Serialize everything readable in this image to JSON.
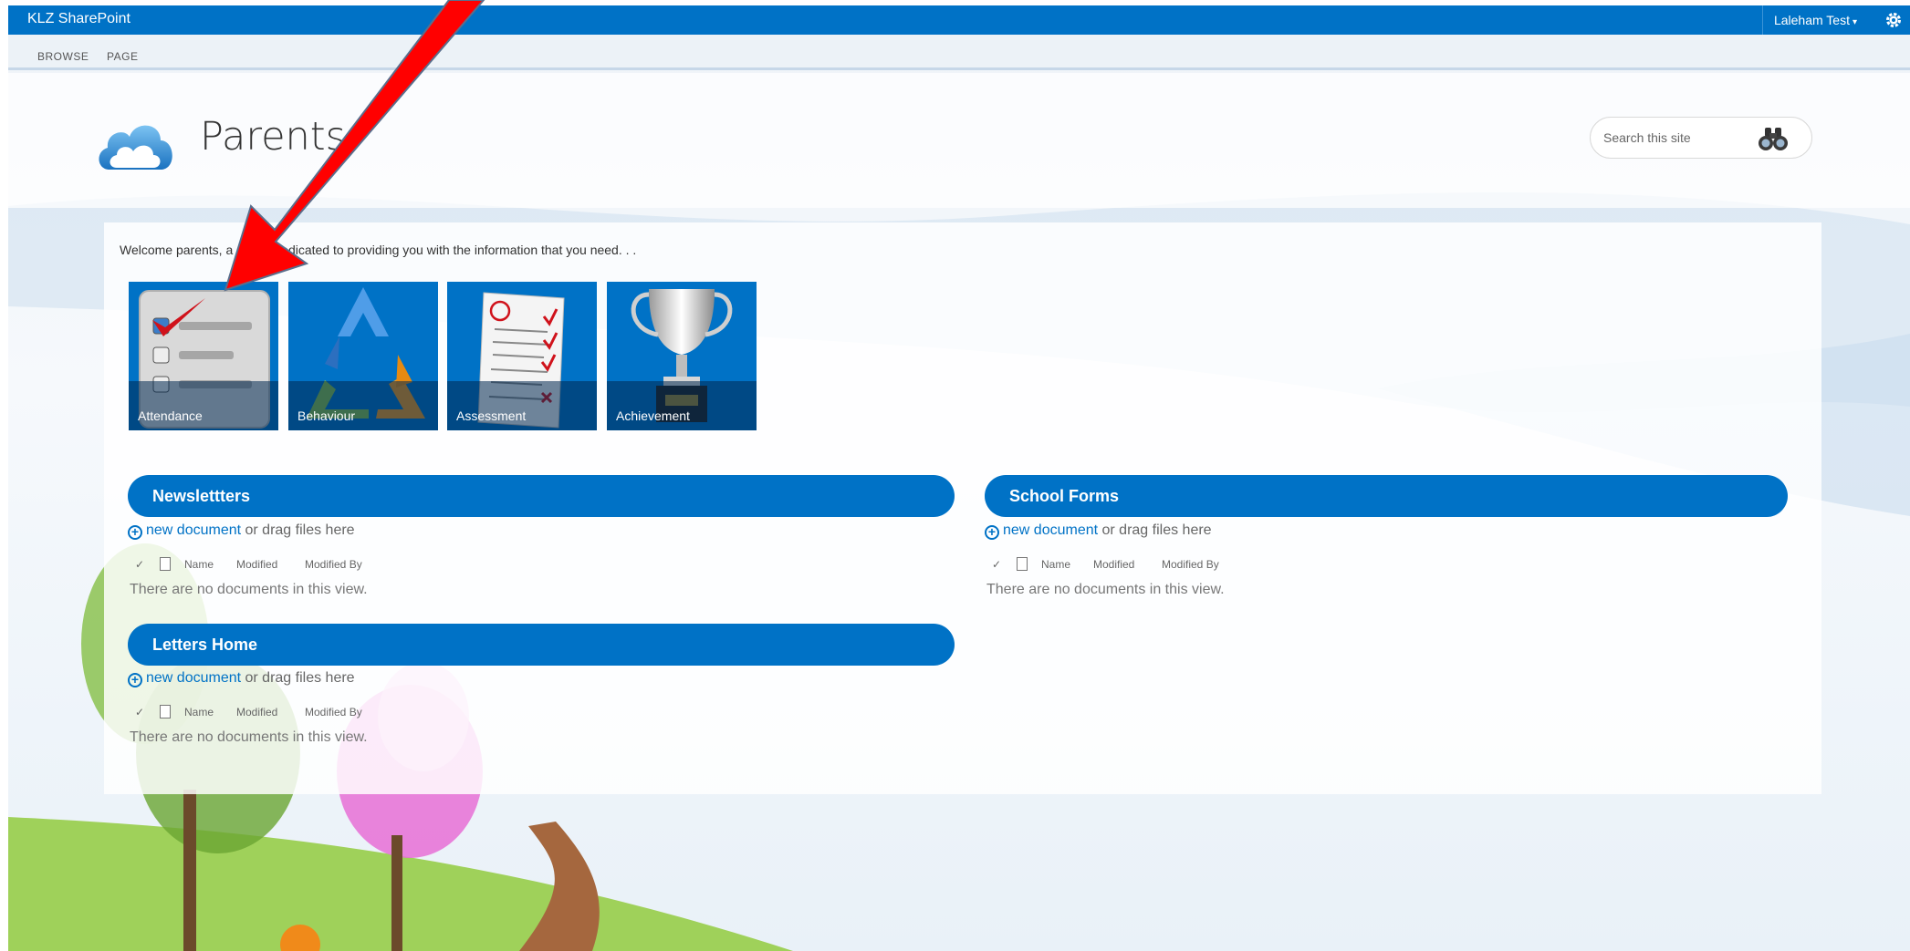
{
  "suite_bar": {
    "brand": "KLZ SharePoint",
    "user": "Laleham Test",
    "user_caret": "▾",
    "settings_icon": "gear-icon",
    "color": "#0072c6"
  },
  "ribbon": {
    "tabs": [
      "BROWSE",
      "PAGE"
    ]
  },
  "site": {
    "title": "Parents",
    "logo_icon": "cloud-logo-icon"
  },
  "search": {
    "placeholder": "Search this site",
    "icon": "binoculars-icon"
  },
  "welcome_text": "Welcome parents, a space dedicated to providing you with the information that you need. . .",
  "tiles": [
    {
      "label": "Attendance",
      "icon": "checklist-icon"
    },
    {
      "label": "Behaviour",
      "icon": "recycle-arrows-icon"
    },
    {
      "label": "Assessment",
      "icon": "marked-paper-icon"
    },
    {
      "label": "Achievement",
      "icon": "trophy-icon"
    }
  ],
  "web_parts": [
    {
      "title": "Newslettters"
    },
    {
      "title": "School Forms"
    },
    {
      "title": "Letters Home"
    }
  ],
  "library": {
    "new_document": "new document",
    "drag_text": " or drag files here",
    "columns": [
      "Name",
      "Modified",
      "Modified By"
    ],
    "check_glyph": "✓",
    "empty_message": "There are no documents in this view."
  },
  "annotation": {
    "arrow_color": "#ff0000",
    "arrow_target": "Attendance"
  }
}
